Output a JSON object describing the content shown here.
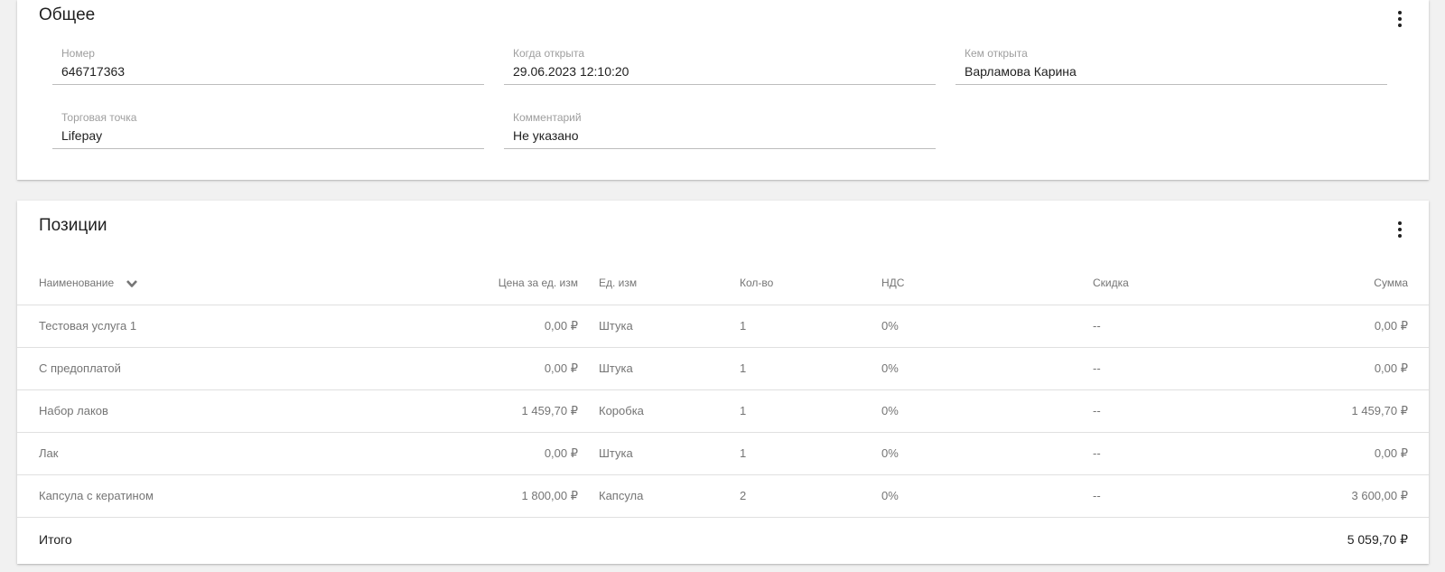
{
  "general": {
    "title": "Общее",
    "fields": {
      "number": {
        "label": "Номер",
        "value": "646717363"
      },
      "opened_at": {
        "label": "Когда открыта",
        "value": "29.06.2023 12:10:20"
      },
      "opened_by": {
        "label": "Кем открыта",
        "value": "Варламова Карина"
      },
      "outlet": {
        "label": "Торговая точка",
        "value": "Lifepay"
      },
      "comment": {
        "label": "Комментарий",
        "value": "Не указано"
      }
    }
  },
  "positions": {
    "title": "Позиции",
    "columns": {
      "name": "Наименование",
      "price": "Цена за ед. изм",
      "unit": "Ед. изм",
      "qty": "Кол-во",
      "vat": "НДС",
      "discount": "Скидка",
      "sum": "Сумма"
    },
    "rows": [
      {
        "name": "Тестовая услуга 1",
        "price": "0,00 ₽",
        "unit": "Штука",
        "qty": "1",
        "vat": "0%",
        "discount": "--",
        "sum": "0,00 ₽"
      },
      {
        "name": "С предоплатой",
        "price": "0,00 ₽",
        "unit": "Штука",
        "qty": "1",
        "vat": "0%",
        "discount": "--",
        "sum": "0,00 ₽"
      },
      {
        "name": "Набор лаков",
        "price": "1 459,70 ₽",
        "unit": "Коробка",
        "qty": "1",
        "vat": "0%",
        "discount": "--",
        "sum": "1 459,70 ₽"
      },
      {
        "name": "Лак",
        "price": "0,00 ₽",
        "unit": "Штука",
        "qty": "1",
        "vat": "0%",
        "discount": "--",
        "sum": "0,00 ₽"
      },
      {
        "name": "Капсула с кератином",
        "price": "1 800,00 ₽",
        "unit": "Капсула",
        "qty": "2",
        "vat": "0%",
        "discount": "--",
        "sum": "3 600,00 ₽"
      }
    ],
    "total": {
      "label": "Итого",
      "value": "5 059,70 ₽"
    }
  },
  "icons": {
    "menu": "more-vert-icon",
    "sort": "chevron-down-icon"
  }
}
